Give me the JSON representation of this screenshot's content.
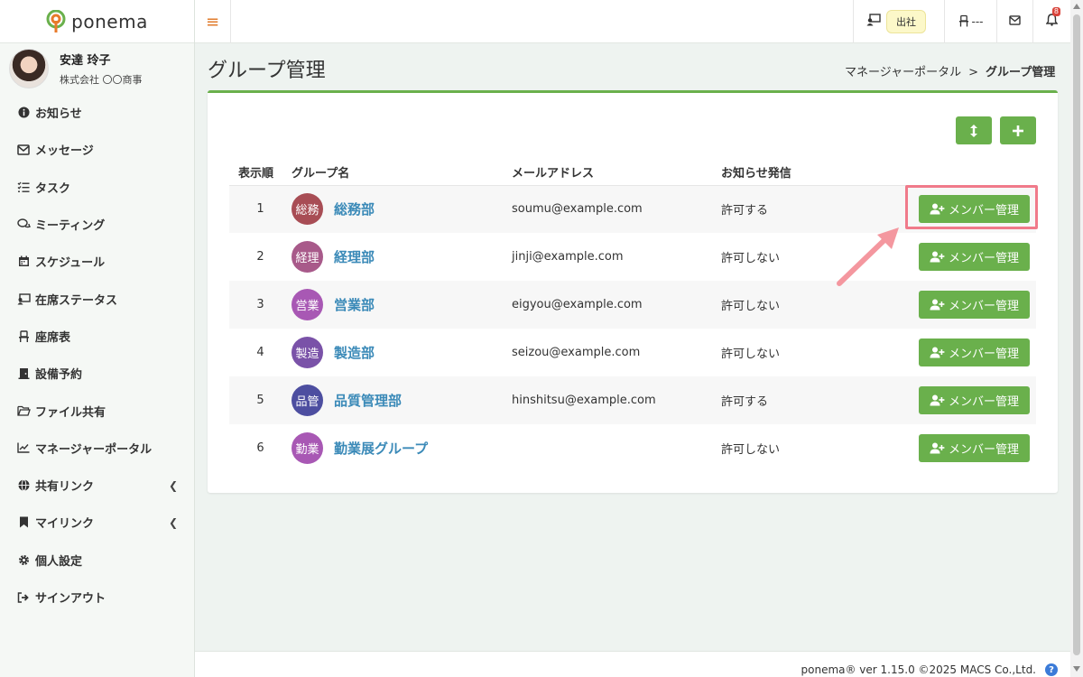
{
  "app": {
    "logo_text": "ponema"
  },
  "user": {
    "name": "安達 玲子",
    "company": "株式会社 〇〇商事"
  },
  "sidebar": {
    "items": [
      {
        "label": "お知らせ",
        "icon": "info-icon"
      },
      {
        "label": "メッセージ",
        "icon": "envelope-icon"
      },
      {
        "label": "タスク",
        "icon": "task-list-icon"
      },
      {
        "label": "ミーティング",
        "icon": "chat-icon"
      },
      {
        "label": "スケジュール",
        "icon": "calendar-icon"
      },
      {
        "label": "在席ステータス",
        "icon": "presence-icon"
      },
      {
        "label": "座席表",
        "icon": "chair-icon"
      },
      {
        "label": "設備予約",
        "icon": "door-icon"
      },
      {
        "label": "ファイル共有",
        "icon": "folder-icon"
      },
      {
        "label": "マネージャーポータル",
        "icon": "chart-icon"
      },
      {
        "label": "共有リンク",
        "icon": "globe-icon"
      },
      {
        "label": "マイリンク",
        "icon": "bookmark-icon"
      },
      {
        "label": "個人設定",
        "icon": "gear-icon"
      },
      {
        "label": "サインアウト",
        "icon": "sign-out-icon"
      }
    ]
  },
  "header": {
    "status_label": "出社",
    "seat_label": "---",
    "notification_count": "8"
  },
  "page": {
    "title": "グループ管理"
  },
  "breadcrumb": {
    "parent": "マネージャーポータル",
    "separator": ">",
    "current": "グループ管理"
  },
  "table": {
    "headers": {
      "order": "表示順",
      "name": "グループ名",
      "email": "メールアドレス",
      "notice": "お知らせ発信"
    },
    "member_button_label": "メンバー管理",
    "rows": [
      {
        "order": "1",
        "badge": "総務",
        "name": "総務部",
        "email": "soumu@example.com",
        "notice": "許可する",
        "badge_color": "#a84d55"
      },
      {
        "order": "2",
        "badge": "経理",
        "name": "経理部",
        "email": "jinji@example.com",
        "notice": "許可しない",
        "badge_color": "#a85a8a"
      },
      {
        "order": "3",
        "badge": "営業",
        "name": "営業部",
        "email": "eigyou@example.com",
        "notice": "許可しない",
        "badge_color": "#a858b4"
      },
      {
        "order": "4",
        "badge": "製造",
        "name": "製造部",
        "email": "seizou@example.com",
        "notice": "許可しない",
        "badge_color": "#7a52a8"
      },
      {
        "order": "5",
        "badge": "品管",
        "name": "品質管理部",
        "email": "hinshitsu@example.com",
        "notice": "許可する",
        "badge_color": "#4d4ea0"
      },
      {
        "order": "6",
        "badge": "勤業",
        "name": "勤業展グループ",
        "email": "",
        "notice": "許可しない",
        "badge_color": "#a858b4"
      }
    ]
  },
  "footer": {
    "text": "ponema® ver 1.15.0 ©2025 MACS Co.,Ltd."
  },
  "colors": {
    "accent": "#6ab04c",
    "link": "#3b8ab8",
    "highlight": "#f07a8a"
  }
}
